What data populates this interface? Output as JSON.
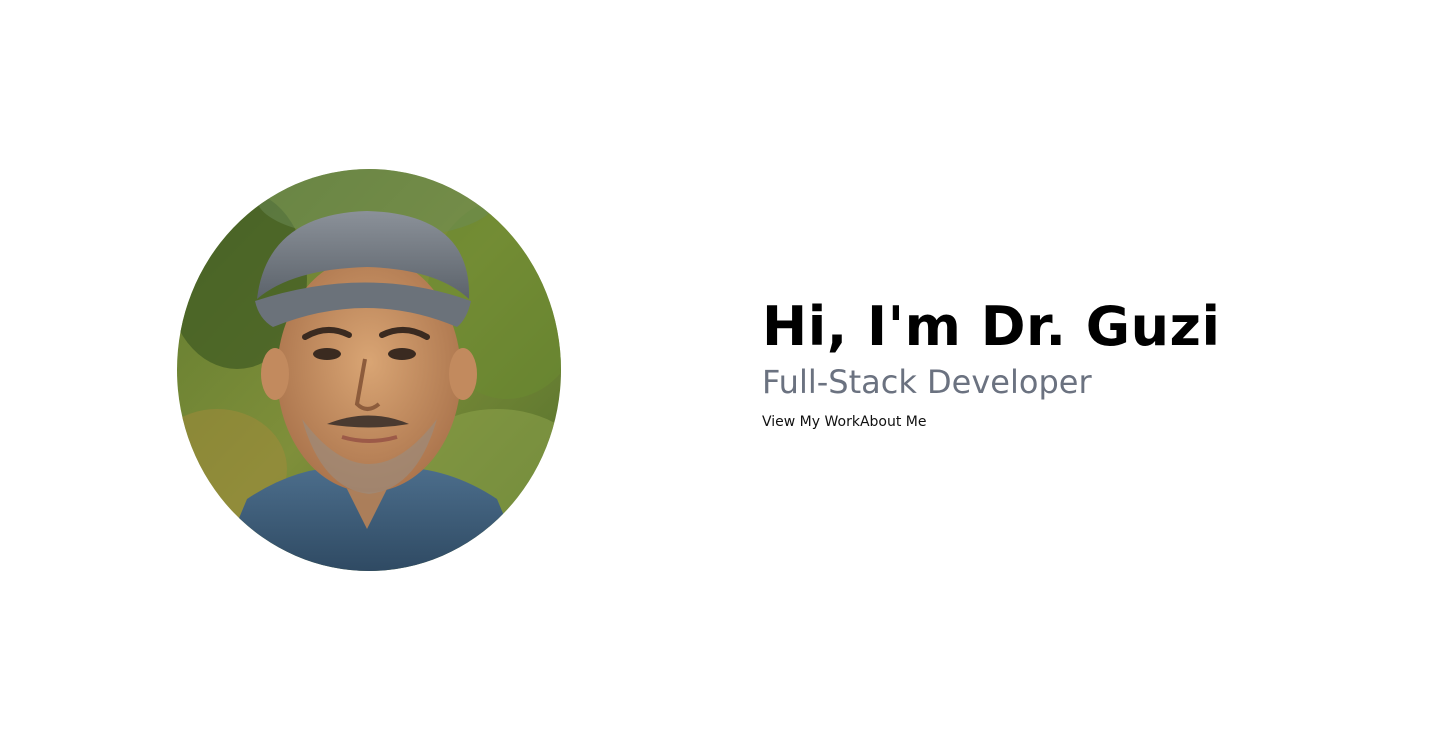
{
  "hero": {
    "portrait_icon": "portrait-photo",
    "headline": "Hi, I'm Dr. Guzi",
    "subtitle": "Full-Stack Developer",
    "links": {
      "work_label": "View My Work",
      "about_label": "About Me"
    }
  },
  "colors": {
    "background": "#ffffff",
    "headline": "#000000",
    "subtitle": "#6b7280",
    "link": "#111111"
  }
}
